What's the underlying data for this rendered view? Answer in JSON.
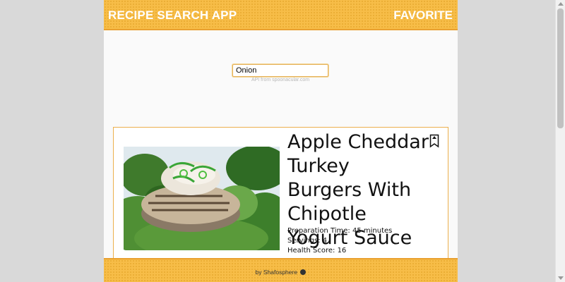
{
  "header": {
    "brand": "RECIPE SEARCH APP",
    "favorite_link": "FAVORITE"
  },
  "search": {
    "value": "Onion",
    "credit": "API from spoonacular.com"
  },
  "recipe": {
    "title": "Apple Cheddar Turkey Burgers With Chipotle Yogurt Sauce",
    "bookmark_icon": "bookmark-icon",
    "preparation": "Preparation Time: 45 minutes",
    "servings": "Servings: 4",
    "health": "Health Score: 16"
  },
  "footer": {
    "text": "by Shafosphere",
    "icon": "github-icon"
  },
  "colors": {
    "accent": "#f7bd48",
    "accent_border": "#e9a02f",
    "page_bg": "#fafafa"
  }
}
